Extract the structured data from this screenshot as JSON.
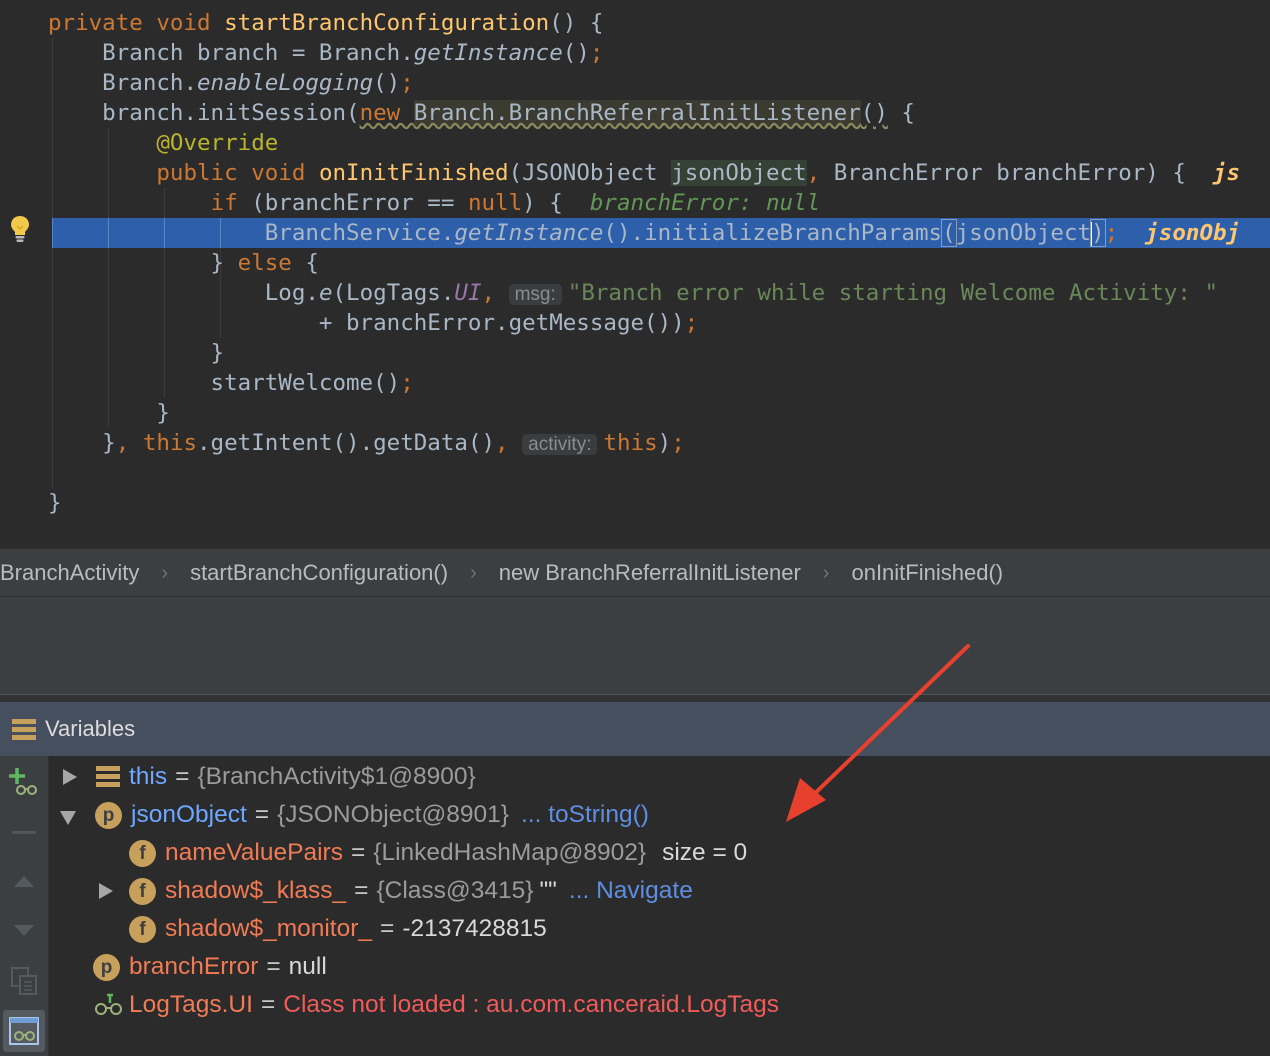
{
  "editor": {
    "lines": [
      {
        "frag": [
          {
            "t": "private ",
            "c": "kw"
          },
          {
            "t": "void ",
            "c": "kw"
          },
          {
            "t": "startBranchConfiguration",
            "c": "fn"
          },
          {
            "t": "() {"
          }
        ]
      },
      {
        "frag": [
          {
            "t": "    Branch branch = Branch."
          },
          {
            "t": "getInstance",
            "c": "it"
          },
          {
            "t": "()"
          },
          {
            "t": ";",
            "c": "kw"
          }
        ]
      },
      {
        "frag": [
          {
            "t": "    Branch."
          },
          {
            "t": "enableLogging",
            "c": "it"
          },
          {
            "t": "()"
          },
          {
            "t": ";",
            "c": "kw"
          }
        ]
      },
      {
        "frag": [
          {
            "t": "    branch.initSession("
          },
          {
            "t": "new ",
            "c": "kw warn"
          },
          {
            "t": "Branch.BranchReferralInitListener",
            "c": "anon"
          },
          {
            "t": "()",
            "c": "warn"
          },
          {
            "t": " {"
          }
        ]
      },
      {
        "frag": [
          {
            "t": "        "
          },
          {
            "t": "@Override",
            "c": "an"
          }
        ]
      },
      {
        "frag": [
          {
            "t": "        "
          },
          {
            "t": "public ",
            "c": "kw"
          },
          {
            "t": "void ",
            "c": "kw"
          },
          {
            "t": "onInitFinished",
            "c": "fn"
          },
          {
            "t": "(JSONObject "
          },
          {
            "t": "jsonObject",
            "c": "param"
          },
          {
            "t": ", ",
            "c": "kw"
          },
          {
            "t": "BranchError branchError) {  "
          },
          {
            "t": "js",
            "c": "hint-y"
          }
        ]
      },
      {
        "frag": [
          {
            "t": "            "
          },
          {
            "t": "if ",
            "c": "kw"
          },
          {
            "t": "(branchError == "
          },
          {
            "t": "null",
            "c": "kw"
          },
          {
            "t": ") {  "
          },
          {
            "t": "branchError: null",
            "c": "hint"
          }
        ]
      },
      {
        "frag": [
          {
            "t": "                BranchService."
          },
          {
            "t": "getInstance",
            "c": "it"
          },
          {
            "t": "().initializeBranchParams"
          },
          {
            "t": "(",
            "c": "brace-m"
          },
          {
            "t": "jsonObject"
          },
          {
            "t": "",
            "c": "caret"
          },
          {
            "t": ")",
            "c": "brace-m"
          },
          {
            "t": ";",
            "c": "kw"
          },
          {
            "t": "  "
          },
          {
            "t": "jsonObj",
            "c": "hint-y"
          }
        ]
      },
      {
        "frag": [
          {
            "t": "            } "
          },
          {
            "t": "else ",
            "c": "kw"
          },
          {
            "t": "{"
          }
        ]
      },
      {
        "frag": [
          {
            "t": "                Log."
          },
          {
            "t": "e",
            "c": "it"
          },
          {
            "t": "(LogTags."
          },
          {
            "t": "UI",
            "c": "cn"
          },
          {
            "t": ", ",
            "c": "kw"
          },
          {
            "t": "msg:",
            "c": "inlay"
          },
          {
            "t": "\"Branch error while starting Welcome Activity: \"",
            "c": "st"
          }
        ]
      },
      {
        "frag": [
          {
            "t": "                    + branchError.getMessage())"
          },
          {
            "t": ";",
            "c": "kw"
          }
        ]
      },
      {
        "frag": [
          {
            "t": "            }"
          }
        ]
      },
      {
        "frag": [
          {
            "t": "            startWelcome()"
          },
          {
            "t": ";",
            "c": "kw"
          }
        ]
      },
      {
        "frag": [
          {
            "t": "        }"
          }
        ]
      },
      {
        "frag": [
          {
            "t": "    }"
          },
          {
            "t": ", ",
            "c": "kw"
          },
          {
            "t": "this",
            "c": "kw"
          },
          {
            "t": ".getIntent().getData()"
          },
          {
            "t": ", ",
            "c": "kw"
          },
          {
            "t": "activity:",
            "c": "inlay"
          },
          {
            "t": "this",
            "c": "kw"
          },
          {
            "t": ")"
          },
          {
            "t": ";",
            "c": "kw"
          }
        ]
      },
      {
        "frag": []
      },
      {
        "frag": [
          {
            "t": "}"
          }
        ]
      }
    ]
  },
  "breadcrumb": {
    "items": [
      "BranchActivity",
      "startBranchConfiguration()",
      "new BranchReferralInitListener",
      "onInitFinished()"
    ]
  },
  "variables": {
    "title": "Variables",
    "rows": [
      {
        "name": "this",
        "eq": "=",
        "value": "{BranchActivity$1@8900}"
      },
      {
        "name": "jsonObject",
        "badge": "p",
        "eq": "=",
        "value": "{JSONObject@8901}",
        "link": "... toString()"
      },
      {
        "name": "nameValuePairs",
        "badge": "f",
        "eq": "=",
        "value": "{LinkedHashMap@8902}",
        "extra": "size = 0"
      },
      {
        "name": "shadow$_klass_",
        "badge": "f",
        "eq": "=",
        "value": "{Class@3415}",
        "extra": "\"\"",
        "link": "... Navigate"
      },
      {
        "name": "shadow$_monitor_",
        "badge": "f",
        "eq": "=",
        "value": "-2137428815"
      },
      {
        "name": "branchError",
        "badge": "p",
        "eq": "=",
        "value": "null"
      },
      {
        "name": "LogTags.UI",
        "eq": "=",
        "value": "Class not loaded : au.com.canceraid.LogTags"
      }
    ]
  },
  "colors": {
    "accent_red_arrow": "#e8402e",
    "selection": "#2d5fab"
  }
}
